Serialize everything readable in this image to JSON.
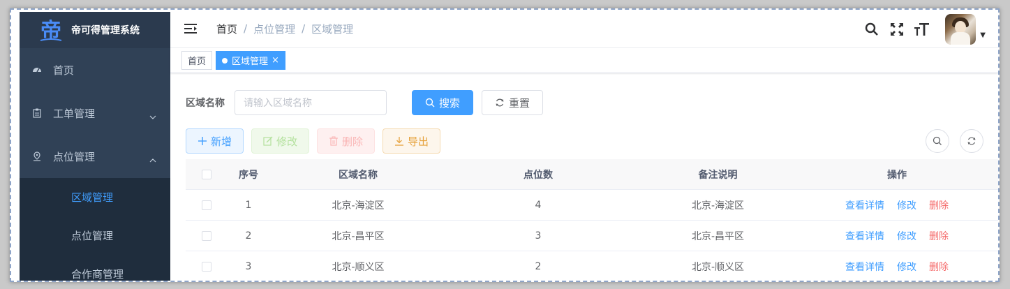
{
  "app": {
    "title": "帝可得管理系统"
  },
  "sidebar": {
    "items": [
      {
        "label": "首页",
        "icon": "dashboard-icon"
      },
      {
        "label": "工单管理",
        "icon": "clipboard-icon",
        "expanded": false
      },
      {
        "label": "点位管理",
        "icon": "location-pin-icon",
        "expanded": true
      }
    ],
    "subitems": [
      {
        "label": "区域管理",
        "active": true
      },
      {
        "label": "点位管理",
        "active": false
      },
      {
        "label": "合作商管理",
        "active": false
      }
    ]
  },
  "breadcrumb": [
    "首页",
    "/",
    "点位管理",
    "/",
    "区域管理"
  ],
  "tags": [
    {
      "label": "首页",
      "active": false
    },
    {
      "label": "区域管理",
      "active": true,
      "close": "×"
    }
  ],
  "search": {
    "label": "区域名称",
    "placeholder": "请输入区域名称",
    "search_button": "搜索",
    "reset_button": "重置"
  },
  "toolbar": {
    "add": "新增",
    "edit": "修改",
    "delete": "删除",
    "export": "导出"
  },
  "table": {
    "headers": [
      "序号",
      "区域名称",
      "点位数",
      "备注说明",
      "操作"
    ],
    "rows": [
      {
        "index": "1",
        "area": "北京-海淀区",
        "count": "4",
        "note": "北京-海淀区"
      },
      {
        "index": "2",
        "area": "北京-昌平区",
        "count": "3",
        "note": "北京-昌平区"
      },
      {
        "index": "3",
        "area": "北京-顺义区",
        "count": "2",
        "note": "北京-顺义区"
      }
    ],
    "ops": {
      "view": "查看详情",
      "edit": "修改",
      "delete": "删除"
    }
  },
  "colors": {
    "sidebar_bg": "#304156",
    "submenu_bg": "#1f2d3d",
    "primary": "#409eff",
    "danger": "#f56c6c",
    "warning": "#e6a23c",
    "success_light": "#b3e19d"
  }
}
